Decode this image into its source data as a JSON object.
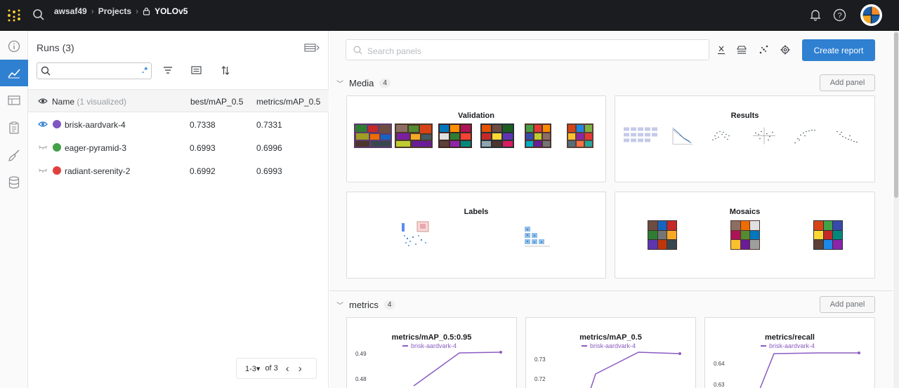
{
  "topbar": {
    "breadcrumb": [
      "awsaf49",
      "Projects",
      "YOLOv5"
    ]
  },
  "runs": {
    "title": "Runs (3)",
    "search_value": "",
    "regex_label": ".*",
    "columns": {
      "name": "Name",
      "visualized": "(1 visualized)",
      "col1": "best/mAP_0.5",
      "col2": "metrics/mAP_0.5"
    },
    "rows": [
      {
        "name": "brisk-aardvark-4",
        "color": "#7e57c2",
        "visible": true,
        "best": "0.7338",
        "metrics": "0.7331"
      },
      {
        "name": "eager-pyramid-3",
        "color": "#43a047",
        "visible": false,
        "best": "0.6993",
        "metrics": "0.6996"
      },
      {
        "name": "radiant-serenity-2",
        "color": "#e0413f",
        "visible": false,
        "best": "0.6992",
        "metrics": "0.6993"
      }
    ],
    "pager": {
      "range": "1-3",
      "total": "of 3"
    }
  },
  "main": {
    "search_placeholder": "Search panels",
    "create_report": "Create report",
    "add_panel": "Add panel",
    "sections": [
      {
        "title": "Media",
        "count": "4"
      },
      {
        "title": "metrics",
        "count": "4"
      }
    ],
    "media_cards": [
      "Validation",
      "Results",
      "Labels",
      "Mosaics"
    ],
    "charts": [
      {
        "title": "metrics/mAP_0.5:0.95",
        "legend": "brisk-aardvark-4",
        "ticks": [
          "0.49",
          "0.48"
        ]
      },
      {
        "title": "metrics/mAP_0.5",
        "legend": "brisk-aardvark-4",
        "ticks": [
          "0.73",
          "0.72"
        ]
      },
      {
        "title": "metrics/recall",
        "legend": "brisk-aardvark-4",
        "ticks": [
          "0.64",
          "0.63"
        ]
      }
    ]
  },
  "colors": {
    "accent": "#2f80d1",
    "series": "#8a5cc2",
    "topbar": "#1a1c1f"
  }
}
